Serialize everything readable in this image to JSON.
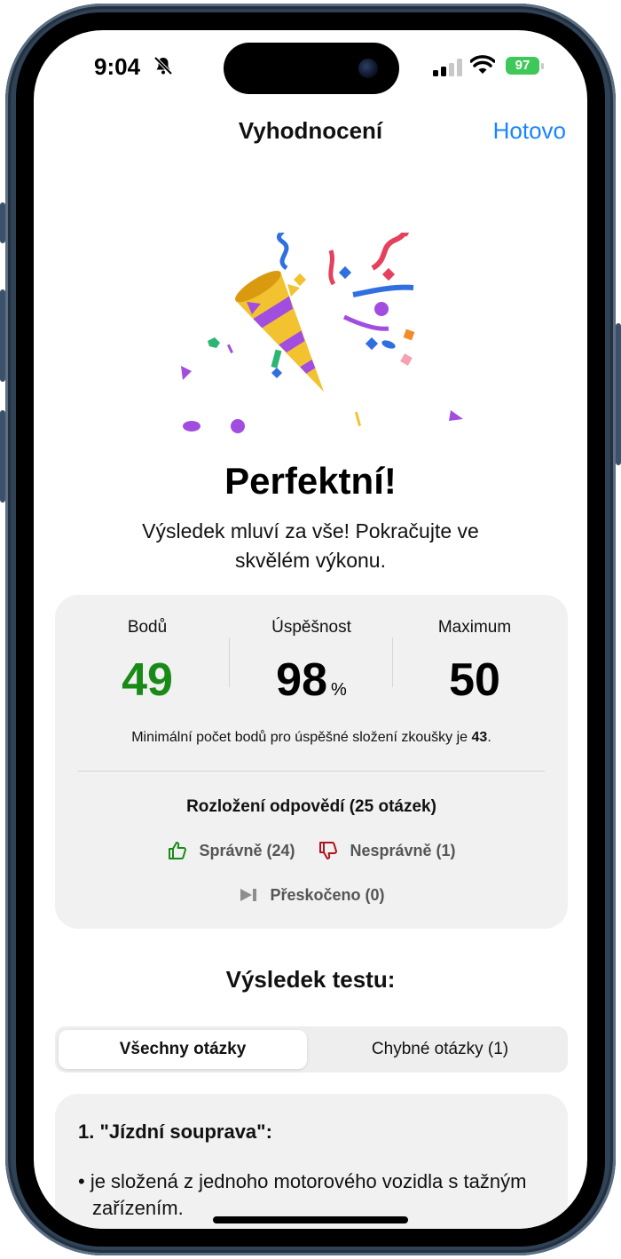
{
  "status_bar": {
    "time": "9:04",
    "battery": "97"
  },
  "nav": {
    "title": "Vyhodnocení",
    "done": "Hotovo"
  },
  "result": {
    "headline": "Perfektní!",
    "subtitle": "Výsledek mluví za vše! Pokračujte ve skvělém výkonu."
  },
  "stats": {
    "points_label": "Bodů",
    "points_value": "49",
    "success_label": "Úspěšnost",
    "success_value": "98",
    "success_unit": "%",
    "max_label": "Maximum",
    "max_value": "50",
    "min_note_prefix": "Minimální počet bodů pro úspěšné složení zkoušky je ",
    "min_note_value": "43",
    "min_note_suffix": ".",
    "distribution_title": "Rozložení odpovědí (25 otázek)",
    "correct": "Správně (24)",
    "wrong": "Nesprávně (1)",
    "skipped": "Přeskočeno (0)"
  },
  "test_result": {
    "title": "Výsledek testu:",
    "tab_all": "Všechny otázky",
    "tab_wrong": "Chybné otázky (1)",
    "question_title": "1. \"Jízdní souprava\":",
    "answer": "• je složená z jednoho motorového vozidla s tažným zařízením."
  },
  "colors": {
    "accent": "#1a84ff",
    "success": "#1a8a17",
    "wrong": "#b3121b",
    "battery": "#3ec85a"
  },
  "icons": [
    "bell-slash-icon",
    "signal-icon",
    "wifi-icon",
    "party-popper-icon",
    "thumbs-up-icon",
    "thumbs-down-icon",
    "skip-forward-icon"
  ]
}
